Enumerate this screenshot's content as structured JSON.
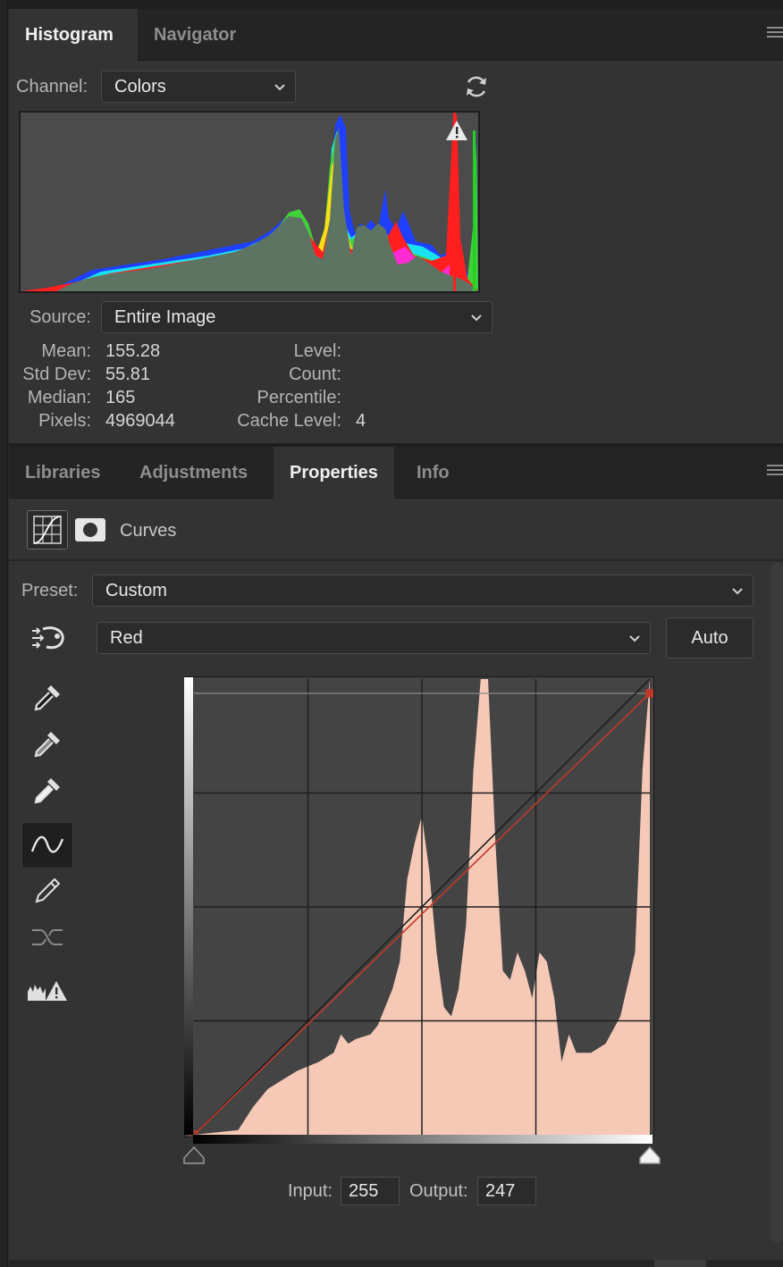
{
  "histogram_panel": {
    "tabs": [
      {
        "label": "Histogram",
        "active": true
      },
      {
        "label": "Navigator",
        "active": false
      }
    ],
    "channel_label": "Channel:",
    "channel_value": "Colors",
    "source_label": "Source:",
    "source_value": "Entire Image",
    "stats": {
      "mean_label": "Mean:",
      "mean": "155.28",
      "stddev_label": "Std Dev:",
      "stddev": "55.81",
      "median_label": "Median:",
      "median": "165",
      "pixels_label": "Pixels:",
      "pixels": "4969044",
      "level_label": "Level:",
      "level": "",
      "count_label": "Count:",
      "count": "",
      "percentile_label": "Percentile:",
      "percentile": "",
      "cache_label": "Cache Level:",
      "cache": "4"
    },
    "icons": [
      "refresh-icon",
      "warning-icon",
      "panel-menu-icon"
    ]
  },
  "properties_panel": {
    "tabs": [
      {
        "label": "Libraries",
        "active": false
      },
      {
        "label": "Adjustments",
        "active": false
      },
      {
        "label": "Properties",
        "active": true
      },
      {
        "label": "Info",
        "active": false
      }
    ],
    "adjustment_title": "Curves",
    "preset_label": "Preset:",
    "preset_value": "Custom",
    "channel_value": "Red",
    "auto_label": "Auto",
    "input_label": "Input:",
    "input_value": "255",
    "output_label": "Output:",
    "output_value": "247",
    "tools": [
      "target-adjust-icon",
      "black-eyedropper-icon",
      "gray-eyedropper-icon",
      "white-eyedropper-icon",
      "curve-edit-icon",
      "pencil-icon",
      "smooth-icon",
      "clipping-warning-icon"
    ]
  },
  "chart_data": {
    "type": "area",
    "title": "",
    "xlabel": "",
    "ylabel": "",
    "xlim": [
      0,
      255
    ],
    "ylim": [
      0,
      255
    ],
    "curve_points": [
      [
        0,
        0
      ],
      [
        255,
        247
      ]
    ],
    "colors": {
      "red_curve": "#c0392b",
      "histogram_fill": "#f6c9b7",
      "baseline": "#1e1e1e"
    }
  },
  "colors": {
    "panel": "#333333",
    "tabbar": "#242424",
    "field": "#2b2b2b",
    "text": "#d6d6d6"
  }
}
